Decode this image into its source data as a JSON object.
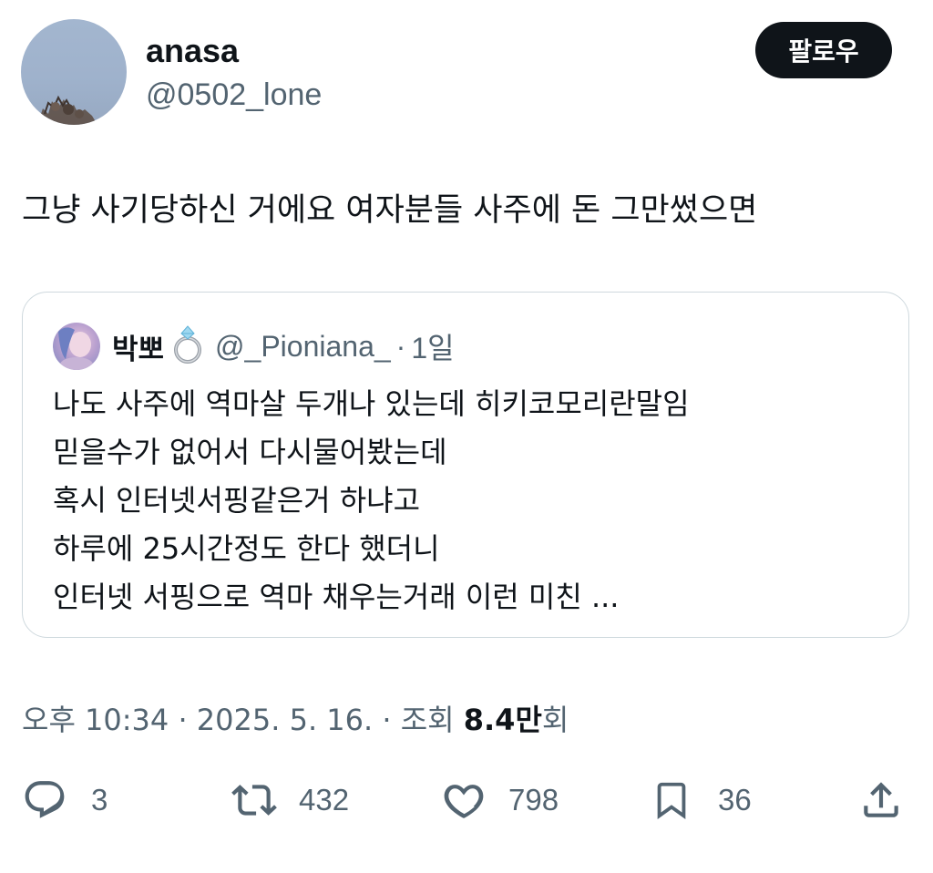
{
  "author": {
    "display_name": "anasa",
    "handle": "@0502_lone",
    "follow_label": "팔로우"
  },
  "tweet": {
    "text": "그냥 사기당하신 거에요 여자분들 사주에 돈 그만썼으면"
  },
  "quote": {
    "name": "박뽀",
    "handle": "@_Pioniana_",
    "separator": "·",
    "time": "1일",
    "lines": [
      "나도 사주에 역마살 두개나 있는데 히키코모리란말임",
      "믿을수가 없어서 다시물어봤는데",
      "혹시 인터넷서핑같은거 하냐고",
      "하루에 25시간정도 한다 했더니",
      "인터넷 서핑으로 역마 채우는거래 이런 미친 ..."
    ]
  },
  "meta": {
    "time": "오후 10:34",
    "date": "2025. 5. 16.",
    "views_label": "조회",
    "views_count": "8.4만",
    "views_suffix": "회",
    "separator": "·"
  },
  "actions": {
    "reply_icon": "reply-icon",
    "reply_count": "3",
    "retweet_icon": "retweet-icon",
    "retweet_count": "432",
    "like_icon": "heart-icon",
    "like_count": "798",
    "bookmark_icon": "bookmark-icon",
    "bookmark_count": "36",
    "share_icon": "share-icon"
  },
  "colors": {
    "text_primary": "#0f1419",
    "text_secondary": "#536471",
    "border": "#cfd9de",
    "button_bg": "#0f1419"
  }
}
